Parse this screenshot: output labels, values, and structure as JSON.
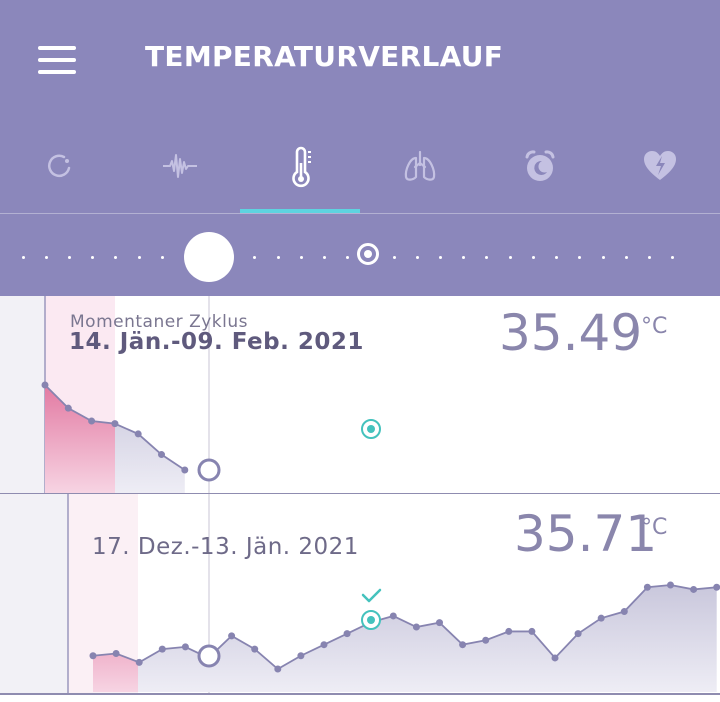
{
  "header": {
    "title": "TEMPERATURVERLAUF",
    "background": "#8b87bb"
  },
  "tabs": [
    {
      "id": "cycle",
      "icon": "cycle-ring-icon",
      "active": false
    },
    {
      "id": "pulse",
      "icon": "waveform-icon",
      "active": false
    },
    {
      "id": "temperature",
      "icon": "thermometer-icon",
      "active": true
    },
    {
      "id": "breathing",
      "icon": "lungs-icon",
      "active": false
    },
    {
      "id": "sleep",
      "icon": "alarm-clock-icon",
      "active": false
    },
    {
      "id": "hrv",
      "icon": "heart-bolt-icon",
      "active": false
    }
  ],
  "accent_color": "#5ed3e0",
  "cycles": [
    {
      "label": "Momentaner Zyklus",
      "range": "14. Jän.-09. Feb. 2021",
      "temperature": "35.49",
      "unit": "°C",
      "values": [
        36.39,
        36.3,
        36.25,
        36.24,
        36.2,
        36.12,
        36.06
      ]
    },
    {
      "label": "",
      "range": "17. Dez.-13. Jän. 2021",
      "temperature": "35.71",
      "unit": "°C",
      "values": [
        35.55,
        35.56,
        35.52,
        35.58,
        35.59,
        35.54,
        35.64,
        35.58,
        35.49,
        35.55,
        35.6,
        35.65,
        35.7,
        35.73,
        35.68,
        35.7,
        35.6,
        35.62,
        35.66,
        35.66,
        35.54,
        35.65,
        35.72,
        35.75,
        35.86,
        35.87,
        35.85,
        35.86
      ]
    }
  ]
}
